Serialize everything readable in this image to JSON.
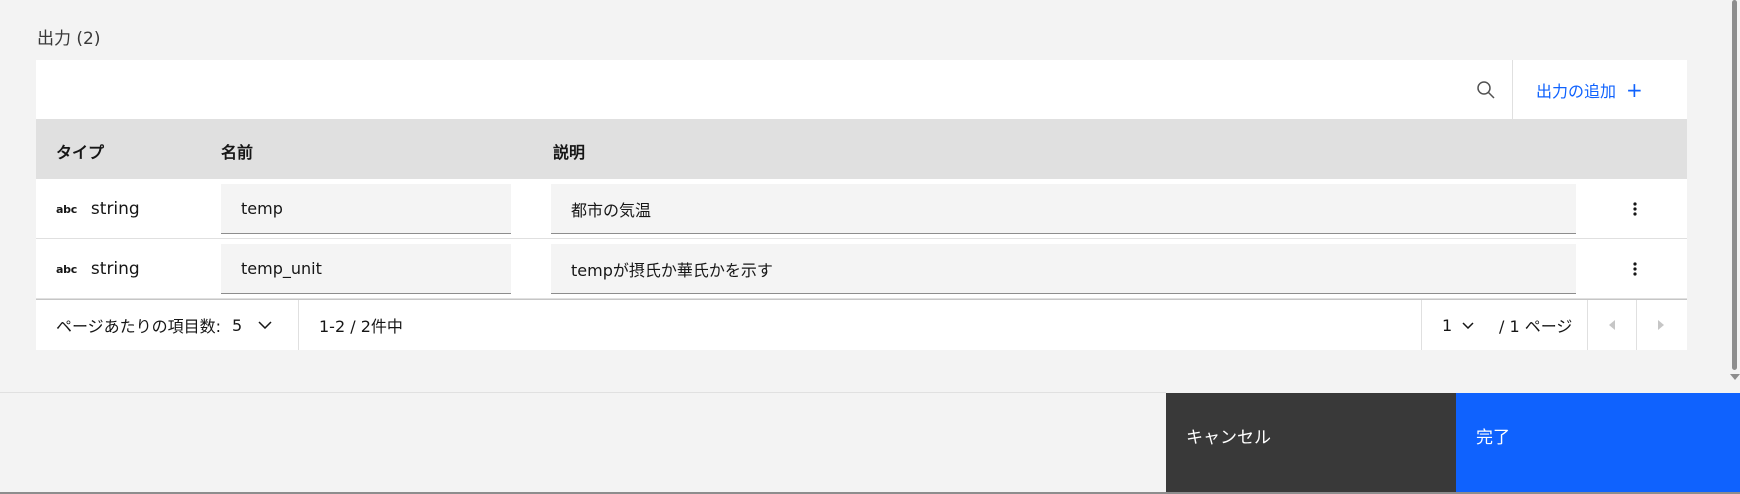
{
  "section": {
    "title": "出力 (2)"
  },
  "toolbar": {
    "add_label": "出力の追加",
    "add_icon": "+"
  },
  "table": {
    "headers": {
      "type": "タイプ",
      "name": "名前",
      "description": "説明"
    },
    "rows": [
      {
        "type_icon": "abc",
        "type": "string",
        "name": "temp",
        "description": "都市の気温"
      },
      {
        "type_icon": "abc",
        "type": "string",
        "name": "temp_unit",
        "description": "tempが摂氏か華氏かを示す"
      }
    ]
  },
  "pagination": {
    "items_per_page_label": "ページあたりの項目数:",
    "items_per_page": "5",
    "range_text": "1-2 / 2件中",
    "current_page": "1",
    "total_pages_text": "/ 1 ページ"
  },
  "footer": {
    "cancel_label": "キャンセル",
    "done_label": "完了"
  },
  "colors": {
    "accent": "#0f62fe",
    "secondary_button": "#393939",
    "header_bg": "#e0e0e0"
  }
}
